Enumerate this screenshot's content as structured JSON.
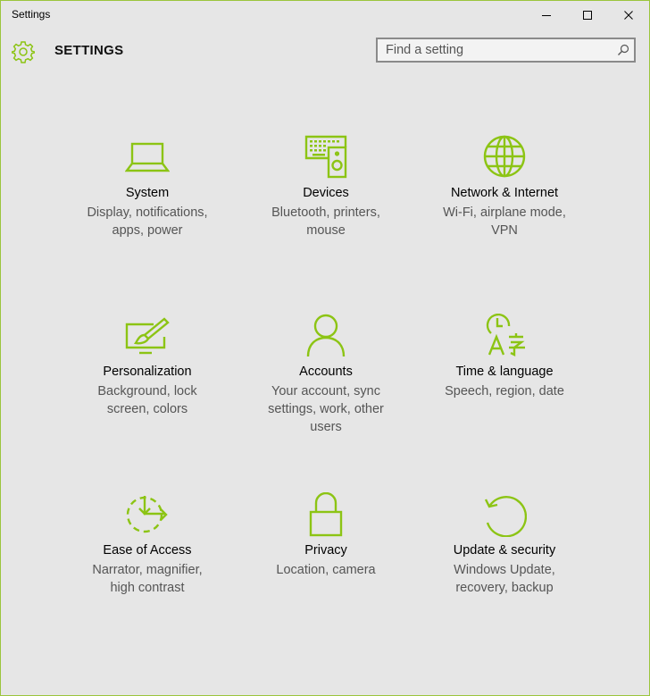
{
  "window": {
    "title": "Settings"
  },
  "header": {
    "title": "SETTINGS"
  },
  "search": {
    "placeholder": "Find a setting"
  },
  "accent_color": "#8cc414",
  "tiles": [
    {
      "label": "System",
      "description": "Display, notifications, apps, power",
      "icon": "laptop-icon"
    },
    {
      "label": "Devices",
      "description": "Bluetooth, printers, mouse",
      "icon": "keyboard-speaker-icon"
    },
    {
      "label": "Network & Internet",
      "description": "Wi-Fi, airplane mode, VPN",
      "icon": "globe-icon"
    },
    {
      "label": "Personalization",
      "description": "Background, lock screen, colors",
      "icon": "paintbrush-monitor-icon"
    },
    {
      "label": "Accounts",
      "description": "Your account, sync settings, work, other users",
      "icon": "person-icon"
    },
    {
      "label": "Time & language",
      "description": "Speech, region, date",
      "icon": "clock-language-icon"
    },
    {
      "label": "Ease of Access",
      "description": "Narrator, magnifier, high contrast",
      "icon": "ease-of-access-icon"
    },
    {
      "label": "Privacy",
      "description": "Location, camera",
      "icon": "lock-icon"
    },
    {
      "label": "Update & security",
      "description": "Windows Update, recovery, backup",
      "icon": "refresh-icon"
    }
  ]
}
